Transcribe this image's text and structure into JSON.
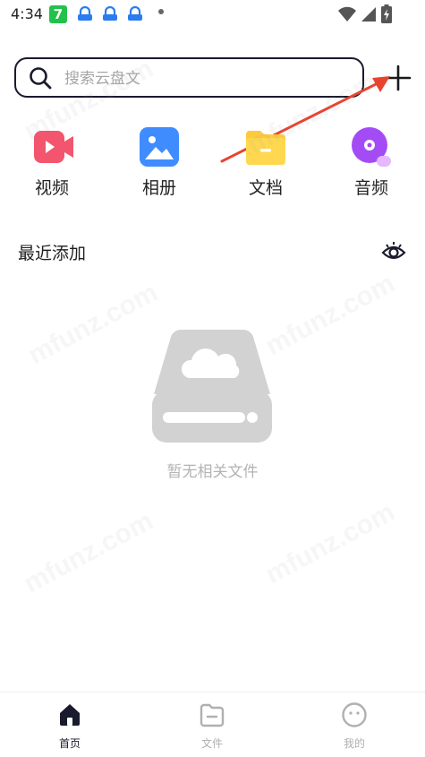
{
  "status_bar": {
    "time": "4:34",
    "notification_badge": "7"
  },
  "search": {
    "placeholder": "搜索云盘文",
    "value": ""
  },
  "categories": [
    {
      "label": "视频",
      "icon": "video-icon",
      "color": "#f2556d"
    },
    {
      "label": "相册",
      "icon": "photo-album-icon",
      "color": "#3f8cff"
    },
    {
      "label": "文档",
      "icon": "document-folder-icon",
      "color": "#ffc93c"
    },
    {
      "label": "音频",
      "icon": "audio-disc-icon",
      "color": "#a34cf5"
    }
  ],
  "recent": {
    "title": "最近添加",
    "empty_text": "暂无相关文件"
  },
  "watermark": "mfunz.com",
  "bottom_nav": [
    {
      "label": "首页",
      "icon": "home-icon",
      "active": true
    },
    {
      "label": "文件",
      "icon": "folder-icon",
      "active": false
    },
    {
      "label": "我的",
      "icon": "profile-face-icon",
      "active": false
    }
  ],
  "colors": {
    "annotation_arrow": "#e8432f",
    "active_nav": "#1a1a2e",
    "inactive_nav": "#b0b0b0"
  }
}
